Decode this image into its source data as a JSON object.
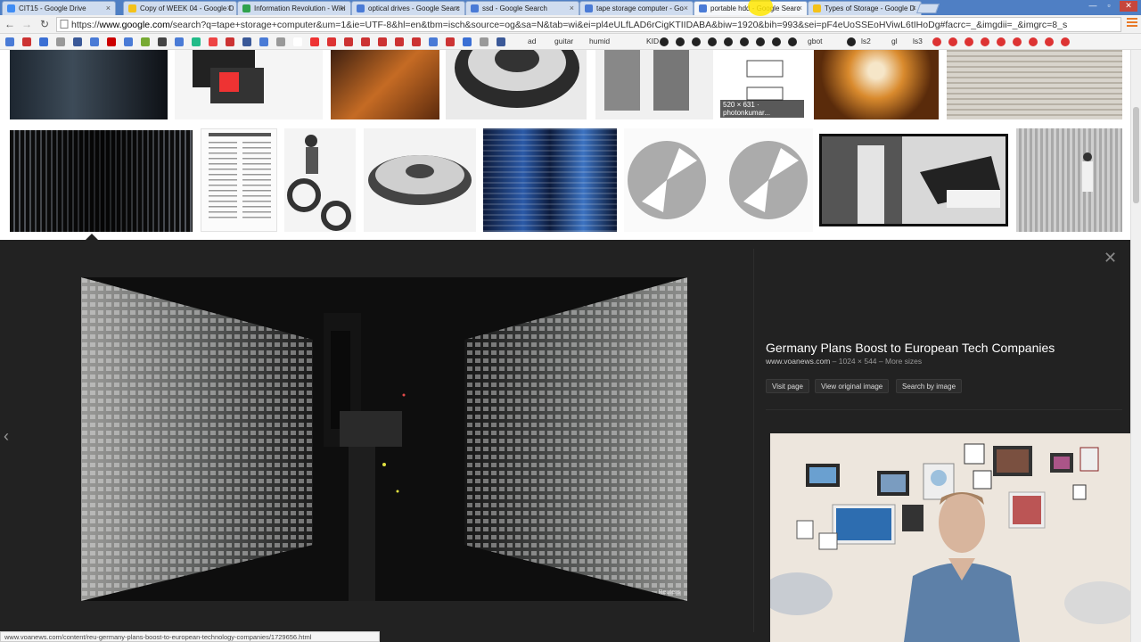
{
  "browser": {
    "tabs": [
      {
        "label": "CIT15 - Google Drive",
        "favicon_color": "#3f8cf4",
        "active": false
      },
      {
        "label": "Copy of WEEK 04 - Google D",
        "favicon_color": "#f4c21b",
        "active": false
      },
      {
        "label": "Information Revolution - Wiki",
        "favicon_color": "#30a24c",
        "active": false
      },
      {
        "label": "optical drives - Google Searc",
        "favicon_color": "#4a7bd6",
        "active": false
      },
      {
        "label": "ssd - Google Search",
        "favicon_color": "#4a7bd6",
        "active": false
      },
      {
        "label": "tape storage computer - Go",
        "favicon_color": "#4a7bd6",
        "active": false
      },
      {
        "label": "portable hdd - Google Searc",
        "favicon_color": "#4a7bd6",
        "active": true
      },
      {
        "label": "Types of Storage - Google D",
        "favicon_color": "#f4c21b",
        "active": false
      }
    ],
    "url_scheme": "https://",
    "url_host": "www.google.com",
    "url_rest": "/search?q=tape+storage+computer&um=1&ie=UTF-8&hl=en&tbm=isch&source=og&sa=N&tab=wi&ei=pl4eULfLAD6rCigKTIIDABA&biw=1920&bih=993&sei=pF4eUoSSEoHViwL6tIHoDg#facrc=_&imgdii=_&imgrc=8_s",
    "status_url": "www.voanews.com/content/reu-germany-plans-boost-to-european-technology-companies/1729656.html"
  },
  "bookmarks": {
    "labels": [
      "ad",
      "guitar",
      "humid",
      "KID",
      "gbot",
      "ls2",
      "gl",
      "ls3"
    ]
  },
  "results": {
    "thumbs_row1": [
      {
        "caption": ""
      },
      {
        "caption": ""
      },
      {
        "caption": ""
      },
      {
        "caption": ""
      },
      {
        "caption": ""
      },
      {
        "caption": "520 × 631 · photonkumar..."
      },
      {
        "caption": ""
      },
      {
        "caption": ""
      }
    ]
  },
  "preview": {
    "title": "Germany Plans Boost to European Tech Companies",
    "site": "www.voanews.com",
    "size": "1024 × 544",
    "more_sizes": "More sizes",
    "credit": "Reuters",
    "buttons": {
      "visit": "Visit page",
      "original": "View original image",
      "search_by": "Search by image"
    }
  },
  "colors": {
    "accent_blue": "#4f7fc4",
    "preview_bg": "#222222"
  }
}
